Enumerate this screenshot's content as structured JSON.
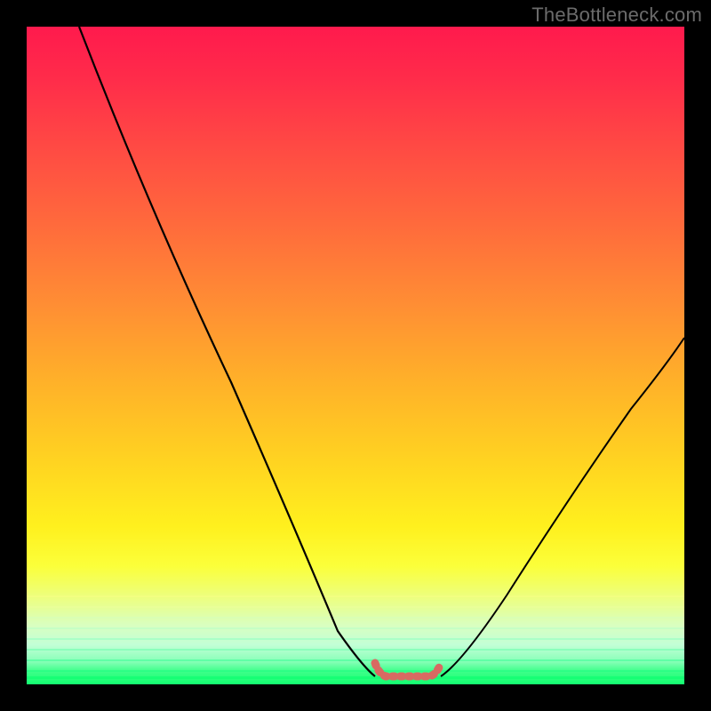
{
  "watermark": "TheBottleneck.com",
  "chart_data": {
    "type": "line",
    "title": "",
    "xlabel": "",
    "ylabel": "",
    "xlim": [
      0,
      100
    ],
    "ylim": [
      0,
      100
    ],
    "grid": false,
    "series": [
      {
        "name": "left-curve",
        "x": [
          8,
          18,
          28,
          38,
          45,
          50,
          53
        ],
        "y": [
          100,
          74,
          49,
          25,
          9,
          2,
          0.5
        ]
      },
      {
        "name": "right-curve",
        "x": [
          63,
          68,
          76,
          84,
          92,
          100
        ],
        "y": [
          0.5,
          3,
          12,
          24,
          37,
          50
        ]
      }
    ],
    "marker": {
      "name": "optimal-zone",
      "color": "#d86a62",
      "x": [
        53,
        55,
        57,
        58.5,
        60,
        61.5,
        63
      ],
      "y": [
        2.5,
        0.8,
        0.6,
        0.6,
        0.6,
        0.8,
        2.5
      ]
    },
    "annotations": []
  },
  "colors": {
    "frame": "#000000",
    "watermark": "#6b6b6b",
    "curve": "#000000",
    "marker": "#d86a62"
  }
}
